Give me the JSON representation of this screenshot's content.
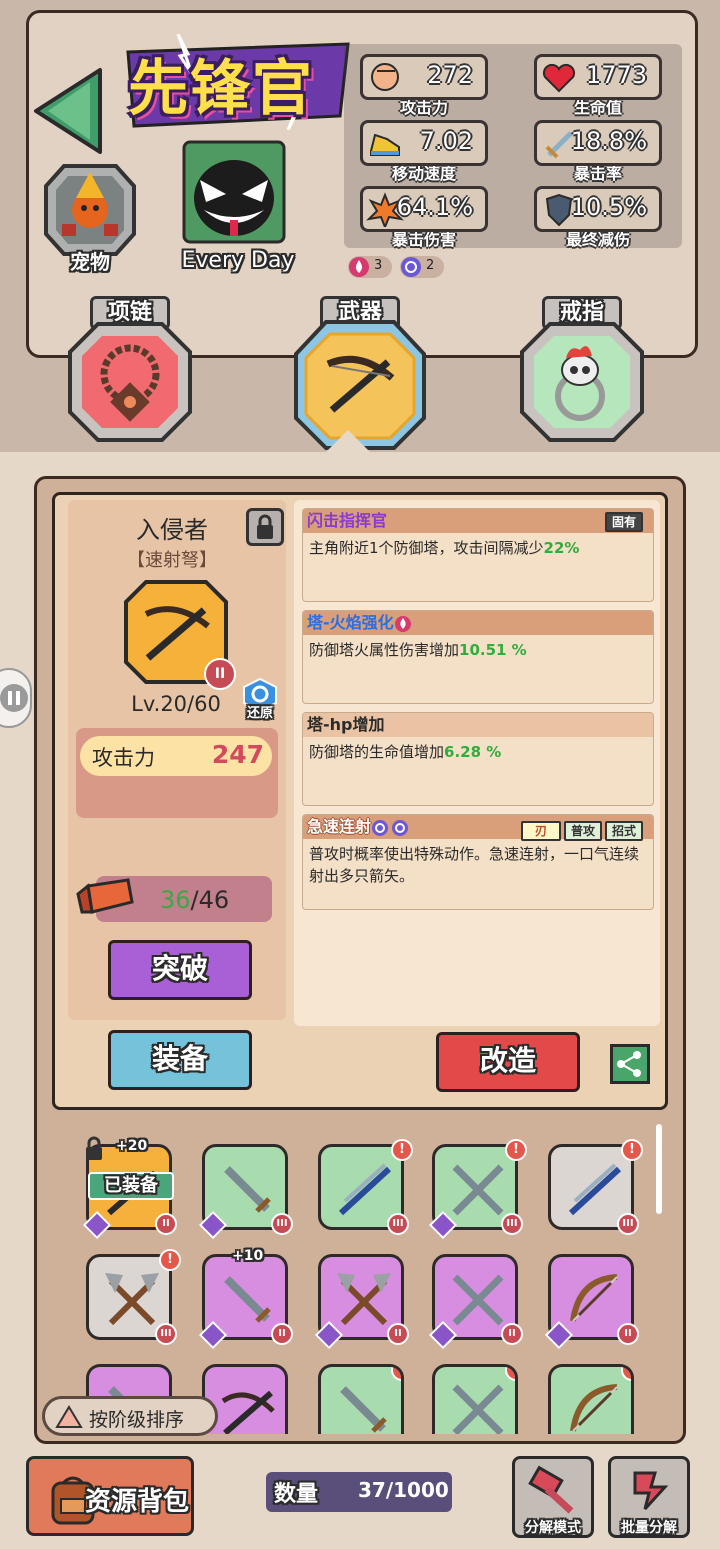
{
  "title": "先锋官",
  "pet": {
    "label": "宠物"
  },
  "hero": {
    "name": "Every Day"
  },
  "stats": [
    {
      "value": "272",
      "label": "攻击力",
      "icon": "fist-icon"
    },
    {
      "value": "1773",
      "label": "生命值",
      "icon": "heart-icon"
    },
    {
      "value": "7.02",
      "label": "移动速度",
      "icon": "shoe-icon"
    },
    {
      "value": "18.8%",
      "label": "暴击率",
      "icon": "sword-icon"
    },
    {
      "value": "64.1%",
      "label": "暴击伤害",
      "icon": "explosion-icon"
    },
    {
      "value": "10.5%",
      "label": "最终减伤",
      "icon": "shield-icon"
    }
  ],
  "badges": [
    {
      "value": "3",
      "icon": "fire-icon"
    },
    {
      "value": "2",
      "icon": "swirl-icon"
    }
  ],
  "equip_tabs": [
    {
      "label": "项链"
    },
    {
      "label": "武器"
    },
    {
      "label": "戒指"
    }
  ],
  "item": {
    "name": "入侵者",
    "type": "【速射弩】",
    "level": "Lv.20/60",
    "restore": "还原",
    "atk_label": "攻击力",
    "atk_value": "247",
    "mat_have": "36",
    "mat_need": "/46",
    "breakthrough": "突破",
    "equip": "装备",
    "reforge": "改造"
  },
  "skills": [
    {
      "title": "闪击指挥官",
      "tags": [
        "固有"
      ],
      "desc": "主角附近1个防御塔，攻击间隔减少",
      "value": "22%"
    },
    {
      "title": "塔-火焰强化",
      "tags": [],
      "desc": "防御塔火属性伤害增加",
      "value": "10.51 %"
    },
    {
      "title": "塔-hp增加",
      "tags": [],
      "desc": "防御塔的生命值增加",
      "value": "6.28 %"
    },
    {
      "title": "急速连射",
      "tags": [
        "刃",
        "普攻",
        "招式"
      ],
      "desc": "普攻时概率使出特殊动作。急速连射，一口气连续射出多只箭矢。",
      "value": ""
    }
  ],
  "inventory": {
    "equipped_label": "已装备",
    "plus_a": "+20",
    "plus_b": "+10",
    "sort_label": "按阶级排序"
  },
  "bottom": {
    "backpack": "资源背包",
    "count_label": "数量",
    "count_value": "37/1000",
    "disassemble": "分解模式",
    "batch": "批量分解"
  },
  "colors": {
    "orange": "#f6b13c",
    "green": "#a8dcae",
    "purple": "#d88ee0",
    "grey": "#dcd6d2",
    "red": "#e5524a",
    "blue": "#7cc7e0"
  }
}
